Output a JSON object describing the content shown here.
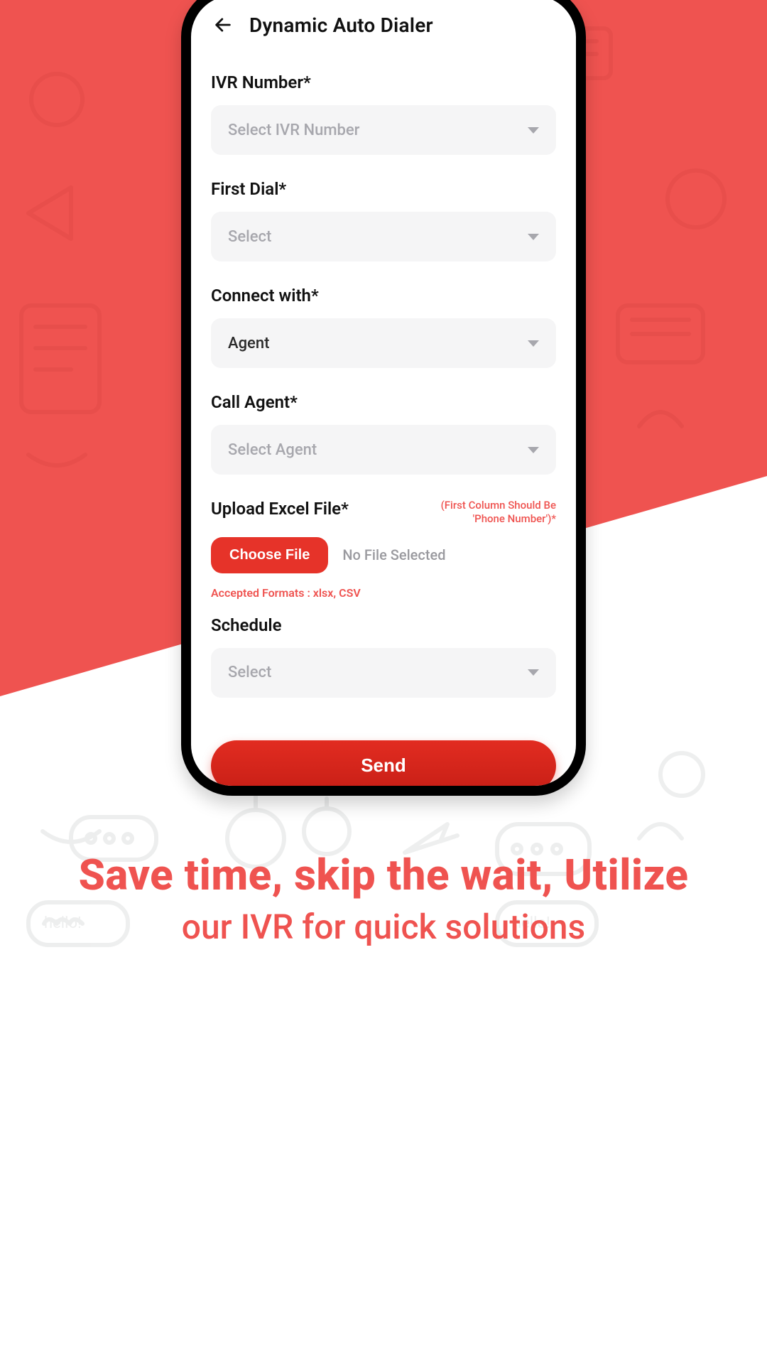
{
  "header": {
    "title": "Dynamic Auto Dialer"
  },
  "form": {
    "ivr_number": {
      "label": "IVR Number*",
      "placeholder": "Select IVR Number"
    },
    "first_dial": {
      "label": "First Dial*",
      "placeholder": "Select"
    },
    "connect_with": {
      "label": "Connect with*",
      "value": "Agent"
    },
    "call_agent": {
      "label": "Call Agent*",
      "placeholder": "Select Agent"
    },
    "upload": {
      "label": "Upload Excel File*",
      "hint": "(First Column Should Be 'Phone Number')*",
      "button": "Choose File",
      "status": "No File Selected",
      "accepted": "Accepted Formats : xlsx, CSV"
    },
    "schedule": {
      "label": "Schedule",
      "placeholder": "Select"
    },
    "send_button": "Send"
  },
  "caption": {
    "line1": "Save time, skip the wait, Utilize",
    "line2": "our IVR for quick solutions"
  },
  "colors": {
    "accent": "#ef5350",
    "primary_button": "#d9261c"
  }
}
